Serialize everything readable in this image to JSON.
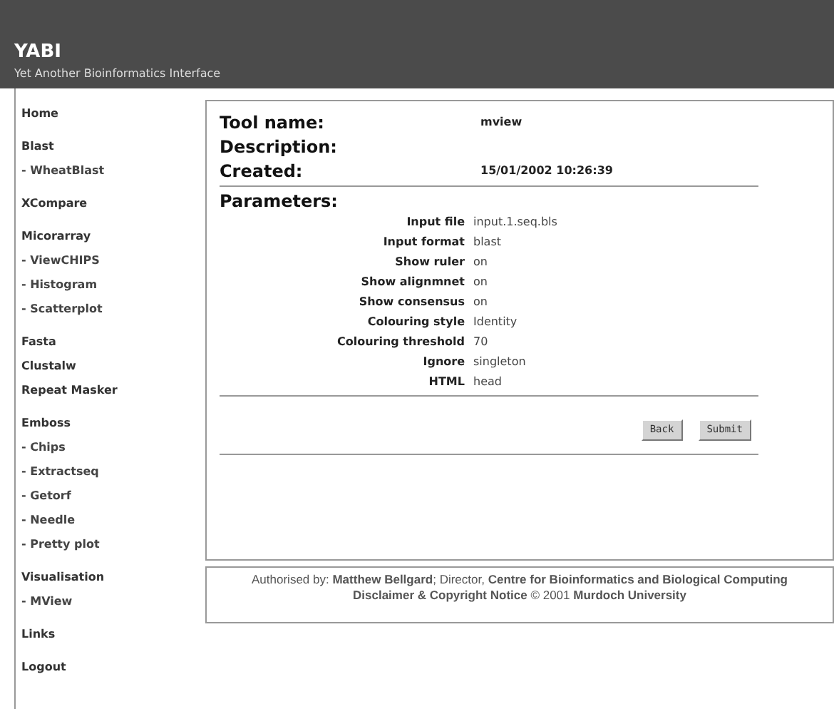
{
  "header": {
    "title": "YABI",
    "subtitle": "Yet Another Bioinformatics Interface"
  },
  "sidebar": {
    "groups": [
      {
        "items": [
          {
            "label": "Home",
            "kind": "section"
          }
        ]
      },
      {
        "items": [
          {
            "label": "Blast",
            "kind": "section"
          },
          {
            "label": "- WheatBlast",
            "kind": "sub"
          }
        ]
      },
      {
        "items": [
          {
            "label": "XCompare",
            "kind": "section"
          }
        ]
      },
      {
        "items": [
          {
            "label": "Micorarray",
            "kind": "section"
          },
          {
            "label": "- ViewCHIPS",
            "kind": "sub"
          },
          {
            "label": "- Histogram",
            "kind": "sub"
          },
          {
            "label": "- Scatterplot",
            "kind": "sub"
          }
        ]
      },
      {
        "items": [
          {
            "label": "Fasta",
            "kind": "section"
          },
          {
            "label": "Clustalw",
            "kind": "section"
          },
          {
            "label": "Repeat Masker",
            "kind": "section"
          }
        ]
      },
      {
        "items": [
          {
            "label": "Emboss",
            "kind": "section"
          },
          {
            "label": "- Chips",
            "kind": "sub"
          },
          {
            "label": "- Extractseq",
            "kind": "sub"
          },
          {
            "label": "- Getorf",
            "kind": "sub"
          },
          {
            "label": "- Needle",
            "kind": "sub"
          },
          {
            "label": "- Pretty plot",
            "kind": "sub"
          }
        ]
      },
      {
        "items": [
          {
            "label": "Visualisation",
            "kind": "section"
          },
          {
            "label": "- MView",
            "kind": "sub"
          }
        ]
      },
      {
        "items": [
          {
            "label": "Links",
            "kind": "section"
          }
        ]
      },
      {
        "items": [
          {
            "label": "Logout",
            "kind": "section"
          }
        ]
      }
    ]
  },
  "details": [
    {
      "label": "Tool name:",
      "value": "mview"
    },
    {
      "label": "Description:"
    },
    {
      "label": "Created:",
      "value": "15/01/2002 10:26:39"
    }
  ],
  "parameters": {
    "heading": "Parameters:",
    "rows": [
      {
        "label": "Input file",
        "value": "input.1.seq.bls"
      },
      {
        "label": "Input format",
        "value": "blast"
      },
      {
        "label": "Show ruler",
        "value": "on"
      },
      {
        "label": "Show alignmnet",
        "value": "on"
      },
      {
        "label": "Show consensus",
        "value": "on"
      },
      {
        "label": "Colouring style",
        "value": "Identity"
      },
      {
        "label": "Colouring threshold",
        "value": "70"
      },
      {
        "label": "Ignore",
        "value": "singleton"
      },
      {
        "label": "HTML",
        "value": "head"
      }
    ]
  },
  "buttons": [
    "Back",
    "Submit"
  ],
  "footer": {
    "lines": [
      "Authorised by: **Matthew Bellgard**; Director, **Centre for Bioinformatics and Biological Computing**",
      "**Disclaimer & Copyright Notice** © 2001 **Murdoch University**"
    ]
  }
}
